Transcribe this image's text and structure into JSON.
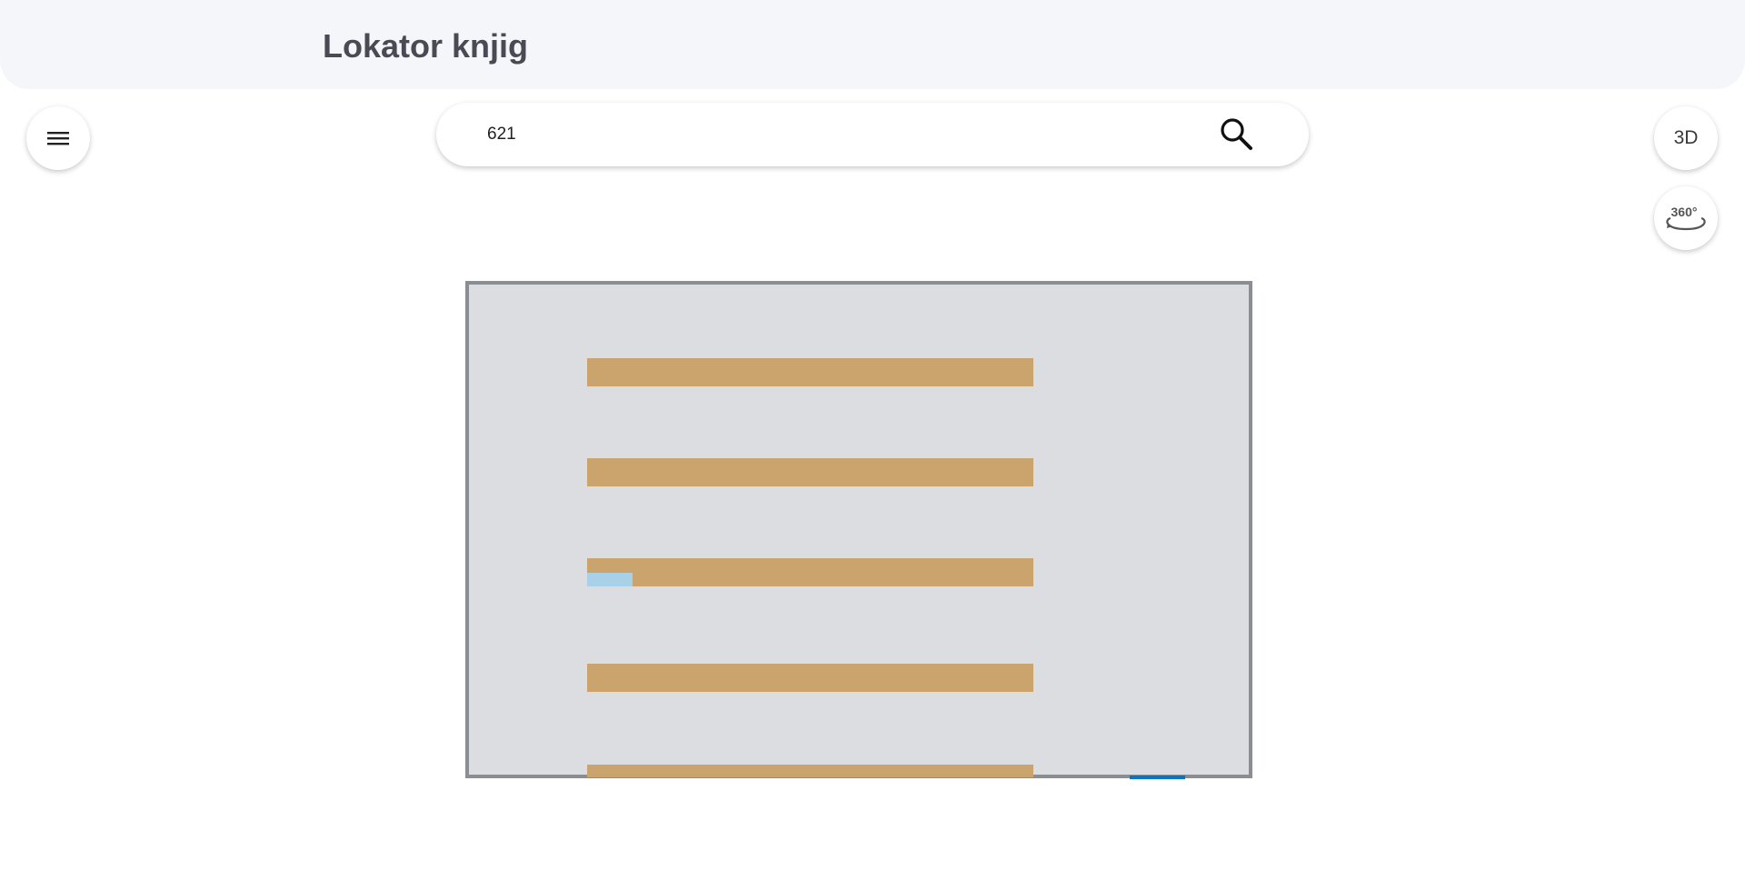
{
  "app": {
    "title": "Lokator knjig"
  },
  "search": {
    "value": "621",
    "placeholder": ""
  },
  "toolbar": {
    "menu_icon": "hamburger-menu-icon",
    "view_3d_label": "3D",
    "view_360_label": "360°"
  },
  "floor_map": {
    "shelf_count": 5,
    "highlighted_shelf_index": 2,
    "colors": {
      "floor": "#dcdde0",
      "wall": "#8a8e93",
      "shelf": "#cba36d",
      "highlight": "#a8d0e6",
      "entrance": "#0077c8"
    }
  }
}
